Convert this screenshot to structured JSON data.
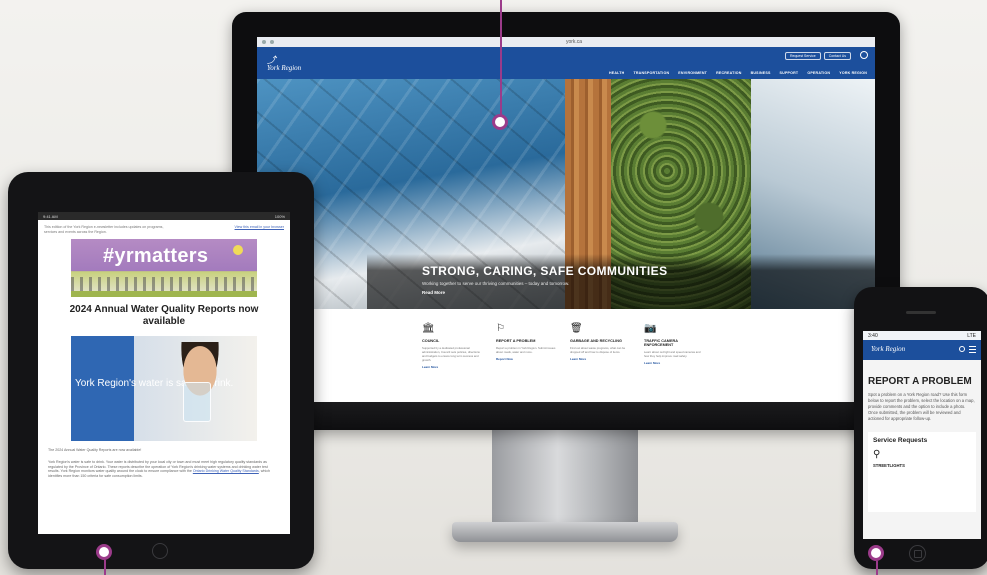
{
  "desktop": {
    "browser_url": "york.ca",
    "header": {
      "logo": "York Region",
      "buttons": [
        "Request Service",
        "Contact Us"
      ],
      "nav": [
        "HEALTH",
        "TRANSPORTATION",
        "ENVIRONMENT",
        "RECREATION",
        "BUSINESS",
        "SUPPORT",
        "OPERATION",
        "YORK REGION"
      ]
    },
    "hero": {
      "title": "STRONG, CARING, SAFE COMMUNITIES",
      "subtitle": "Working together to serve our thriving communities – today and tomorrow.",
      "link": "Read More"
    },
    "services": [
      {
        "icon": "building-icon",
        "title": "COUNCIL",
        "text": "Supported by a dedicated professional administration, Council sets policies, directions and budgets to ensure long term success and growth.",
        "link": "Learn More"
      },
      {
        "icon": "flag-icon",
        "title": "REPORT A PROBLEM",
        "text": "Report a problem in York Region. Submit issues about roads, water and more.",
        "link": "Report Now"
      },
      {
        "icon": "bin-icon",
        "title": "GARBAGE AND RECYCLING",
        "text": "Find out about waste programs, what can be dropped off and how to dispose of items.",
        "link": "Learn More"
      },
      {
        "icon": "camera-icon",
        "title": "TRAFFIC CAMERA ENFORCEMENT",
        "text": "Learn about red light and speed cameras and how they help improve road safety.",
        "link": "Learn More"
      }
    ]
  },
  "tablet": {
    "status_left": "9:41 AM",
    "status_right": "100%",
    "intro": "This edition of the York Region e-newsletter includes updates on programs, services and events across the Region.",
    "intro_link": "View this email in your browser",
    "banner_tag": "#yrmatters",
    "heading": "2024 Annual Water Quality Reports now available",
    "water_text": "York Region's water is safe to drink.",
    "para1": "The 2024 Annual Water Quality Reports are now available!",
    "para2": "York Region's water is safe to drink. Your water is distributed by your local city or town and must meet high regulatory quality standards as regulated by the Province of Ontario. These reports describe the operation of York Region's drinking water systems and drinking water test results. York Region monitors water quality around the clock to ensure compliance with the",
    "para2_link": "Ontario Drinking Water Quality Standards",
    "para2_end": ", which identifies more than 150 criteria for safe consumption limits."
  },
  "phone": {
    "time": "3:40",
    "signal": "LTE",
    "logo": "York Region",
    "title": "REPORT A PROBLEM",
    "text": "Spot a problem on a York Region road? Use this form below to report the problem, select the location on a map, provide comments and the option to include a photo. Once submitted, the problem will be reviewed and actioned for appropriate follow-up.",
    "card_title": "Service Requests",
    "card_icon": "streetlight-icon",
    "card_label": "STREETLIGHTS"
  },
  "colors": {
    "brand_blue": "#1c4f9c",
    "callout_purple": "#9b3b8a"
  }
}
